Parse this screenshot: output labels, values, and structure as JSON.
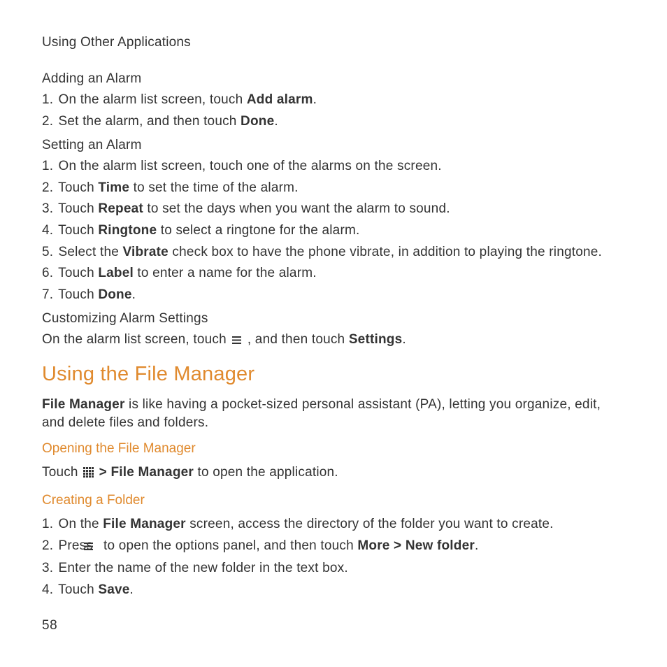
{
  "header": "Using Other Applications",
  "adding": {
    "title": "Adding an Alarm",
    "steps": [
      {
        "num": "1.",
        "pre": "On the alarm list screen, touch ",
        "bold": "Add alarm",
        "post": "."
      },
      {
        "num": "2.",
        "pre": "Set the alarm, and then touch ",
        "bold": "Done",
        "post": "."
      }
    ]
  },
  "setting": {
    "title": "Setting an Alarm",
    "steps": [
      {
        "num": "1.",
        "text": "On the alarm list screen, touch one of the alarms on the screen."
      },
      {
        "num": "2.",
        "pre": "Touch ",
        "bold": "Time",
        "post": " to set the time of the alarm."
      },
      {
        "num": "3.",
        "pre": "Touch ",
        "bold": "Repeat",
        "post": " to set the days when you want the alarm to sound."
      },
      {
        "num": "4.",
        "pre": "Touch ",
        "bold": "Ringtone",
        "post": " to select a ringtone for the alarm."
      },
      {
        "num": "5.",
        "pre": "Select the ",
        "bold": "Vibrate",
        "post": " check box to have the phone vibrate, in addition to playing the ringtone."
      },
      {
        "num": "6.",
        "pre": "Touch ",
        "bold": "Label",
        "post": " to enter a name for the alarm."
      },
      {
        "num": "7.",
        "pre": "Touch ",
        "bold": "Done",
        "post": "."
      }
    ]
  },
  "customizing": {
    "title": "Customizing Alarm Settings",
    "line_pre": "On the alarm list screen, touch ",
    "line_mid": " , and then touch ",
    "line_bold": "Settings",
    "line_post": "."
  },
  "file_manager": {
    "title": "Using the File Manager",
    "intro_bold": "File Manager",
    "intro_rest": " is like having a pocket-sized personal assistant (PA), letting you organize, edit, and delete files and folders."
  },
  "opening": {
    "title": "Opening the File Manager",
    "pre": "Touch ",
    "mid": " > ",
    "bold": "File Manager",
    "post": " to open the application."
  },
  "creating": {
    "title": "Creating a Folder",
    "steps": {
      "s1_num": "1.",
      "s1_pre": "On the ",
      "s1_bold": "File Manager",
      "s1_post": " screen, access the directory of the folder you want to create.",
      "s2_num": "2.",
      "s2_pre": "Press ",
      "s2_mid": " to open the options panel, and then touch ",
      "s2_bold": "More > New folder",
      "s2_post": ".",
      "s3_num": "3.",
      "s3_text": "Enter the name of the new folder in the text box.",
      "s4_num": "4.",
      "s4_pre": "Touch ",
      "s4_bold": "Save",
      "s4_post": "."
    }
  },
  "page_number": "58"
}
